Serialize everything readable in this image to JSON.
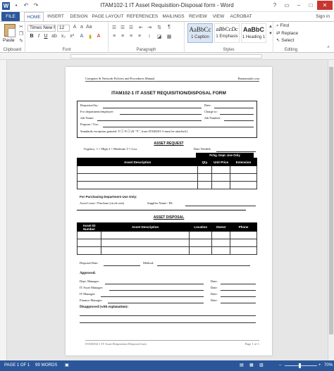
{
  "window": {
    "title": "ITAM102-1 IT Asset Requisition-Disposal form - Word"
  },
  "quick_access": {
    "save_icon": "save-icon",
    "undo_icon": "undo-icon",
    "redo_icon": "redo-icon"
  },
  "tabs": [
    "FILE",
    "HOME",
    "INSERT",
    "DESIGN",
    "PAGE LAYOUT",
    "REFERENCES",
    "MAILINGS",
    "REVIEW",
    "VIEW",
    "ACROBAT"
  ],
  "active_tab": "HOME",
  "signin": "Sign in",
  "ribbon": {
    "clipboard": {
      "paste_label": "Paste",
      "group_label": "Clipboard"
    },
    "font": {
      "font_name": "Times New Ro",
      "font_size": "12",
      "bold": "B",
      "italic": "I",
      "underline": "U",
      "group_label": "Font"
    },
    "paragraph": {
      "group_label": "Paragraph"
    },
    "styles": {
      "items": [
        {
          "sample": "AaBbCc",
          "name": "1 Caption"
        },
        {
          "sample": "aBbCcDc",
          "name": "1 Emphasis"
        },
        {
          "sample": "AaBbC",
          "name": "1 Heading 1"
        }
      ],
      "group_label": "Styles"
    },
    "editing": {
      "find": "Find",
      "replace": "Replace",
      "select": "Select",
      "group_label": "Editing"
    }
  },
  "document": {
    "header_left": "Computer & Network Policies and Procedures Manual",
    "header_right": "Bizmanualz.com",
    "title": "ITAM102-1   IT ASSET REQUISITION/DISPOSAL FORM",
    "request_box": {
      "requested_by": "Requested by:",
      "date": "Date:",
      "dept_employee": "For department/employee:",
      "charge_to": "Charge to:",
      "job_name": "Job Name:",
      "job_number": "Job Number:",
      "purpose": "Purpose / Use:",
      "standards": "Standards exception granted:  Y ☐ N ☐  (If \"Y\", from ITAM101-3 must be attached.)"
    },
    "asset_request": {
      "title": "ASSET REQUEST",
      "urgency": "Urgency:   1 = High    2 = Moderate    3 = Low",
      "date_needed": "Date Needed:",
      "pchg_header": "Pchg. Dept. Use Only",
      "columns": [
        "Asset Description",
        "Qty.",
        "Unit Price",
        "Extension"
      ],
      "row_count": 4
    },
    "purchasing": {
      "title": "For Purchasing Department Use Only:",
      "lease": "Asset Lease / Purchase (circle one)",
      "supplier": "Supplier Name / ID:"
    },
    "asset_disposal": {
      "title": "ASSET DISPOSAL",
      "columns": [
        "Asset ID Number",
        "Asset Description",
        "Location",
        "Owner",
        "Phone"
      ],
      "row_count": 3,
      "disposal_date": "Disposal Date:",
      "method": "Method:"
    },
    "approvals": {
      "approved": "Approved:",
      "dept_manager": "Dept. Manager:",
      "it_asset_manager": "IT Asset Manager:",
      "it_manager": "IT Manager:",
      "finance_manager": "Finance Manager:",
      "date": "Date:",
      "disapproved": "Disapproved (with explanation):"
    },
    "footer_left": "ITAM102-1 IT Asset Requisition-Disposal form",
    "footer_right": "Page 1 of 1"
  },
  "status": {
    "page": "PAGE 1 OF 1",
    "words": "99 WORDS",
    "zoom": "70%"
  }
}
